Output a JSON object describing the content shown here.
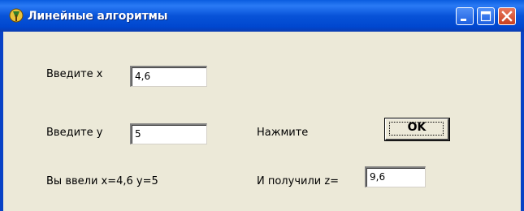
{
  "window": {
    "title": "Линейные алгоритмы",
    "icon": "delphi-app-icon",
    "controls": [
      "minimize-icon",
      "maximize-icon",
      "close-icon"
    ]
  },
  "form": {
    "x_label": "Введите x",
    "x_value": "4,6",
    "y_label": "Введите  y",
    "y_value": "5",
    "press_label": "Нажмите",
    "ok_label": "OK",
    "entered_label": "Вы ввели x=4,6  y=5",
    "result_label": "И получили z=",
    "z_value": "9,6"
  },
  "colors": {
    "titlebar": "#0853d8",
    "face": "#ece9d8",
    "close": "#c8401f"
  }
}
